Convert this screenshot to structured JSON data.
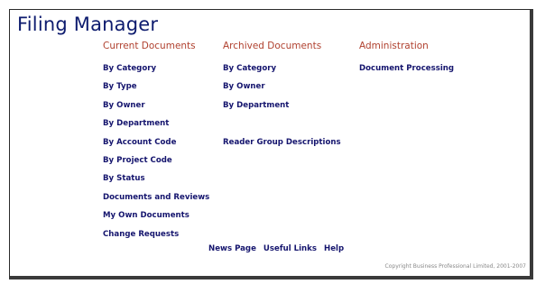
{
  "app": {
    "title": "Filing Manager"
  },
  "current": {
    "heading": "Current Documents",
    "links": [
      "By Category",
      "By Type",
      "By Owner",
      "By Department",
      "By Account Code",
      "By Project Code",
      "By Status",
      "Documents and Reviews",
      "My Own Documents",
      "Change Requests"
    ]
  },
  "archived": {
    "heading": "Archived Documents",
    "links": [
      "By Category",
      "By Owner",
      "By Department",
      "Reader Group Descriptions"
    ]
  },
  "admin": {
    "heading": "Administration",
    "links": [
      "Document Processing"
    ]
  },
  "footer": {
    "links": [
      "News Page",
      "Useful Links",
      "Help"
    ],
    "copyright": "Copyright Business Professional Limited, 2001-2007"
  },
  "colors": {
    "title": "#0d1b6e",
    "heading": "#b0412f",
    "link": "#15156e"
  }
}
